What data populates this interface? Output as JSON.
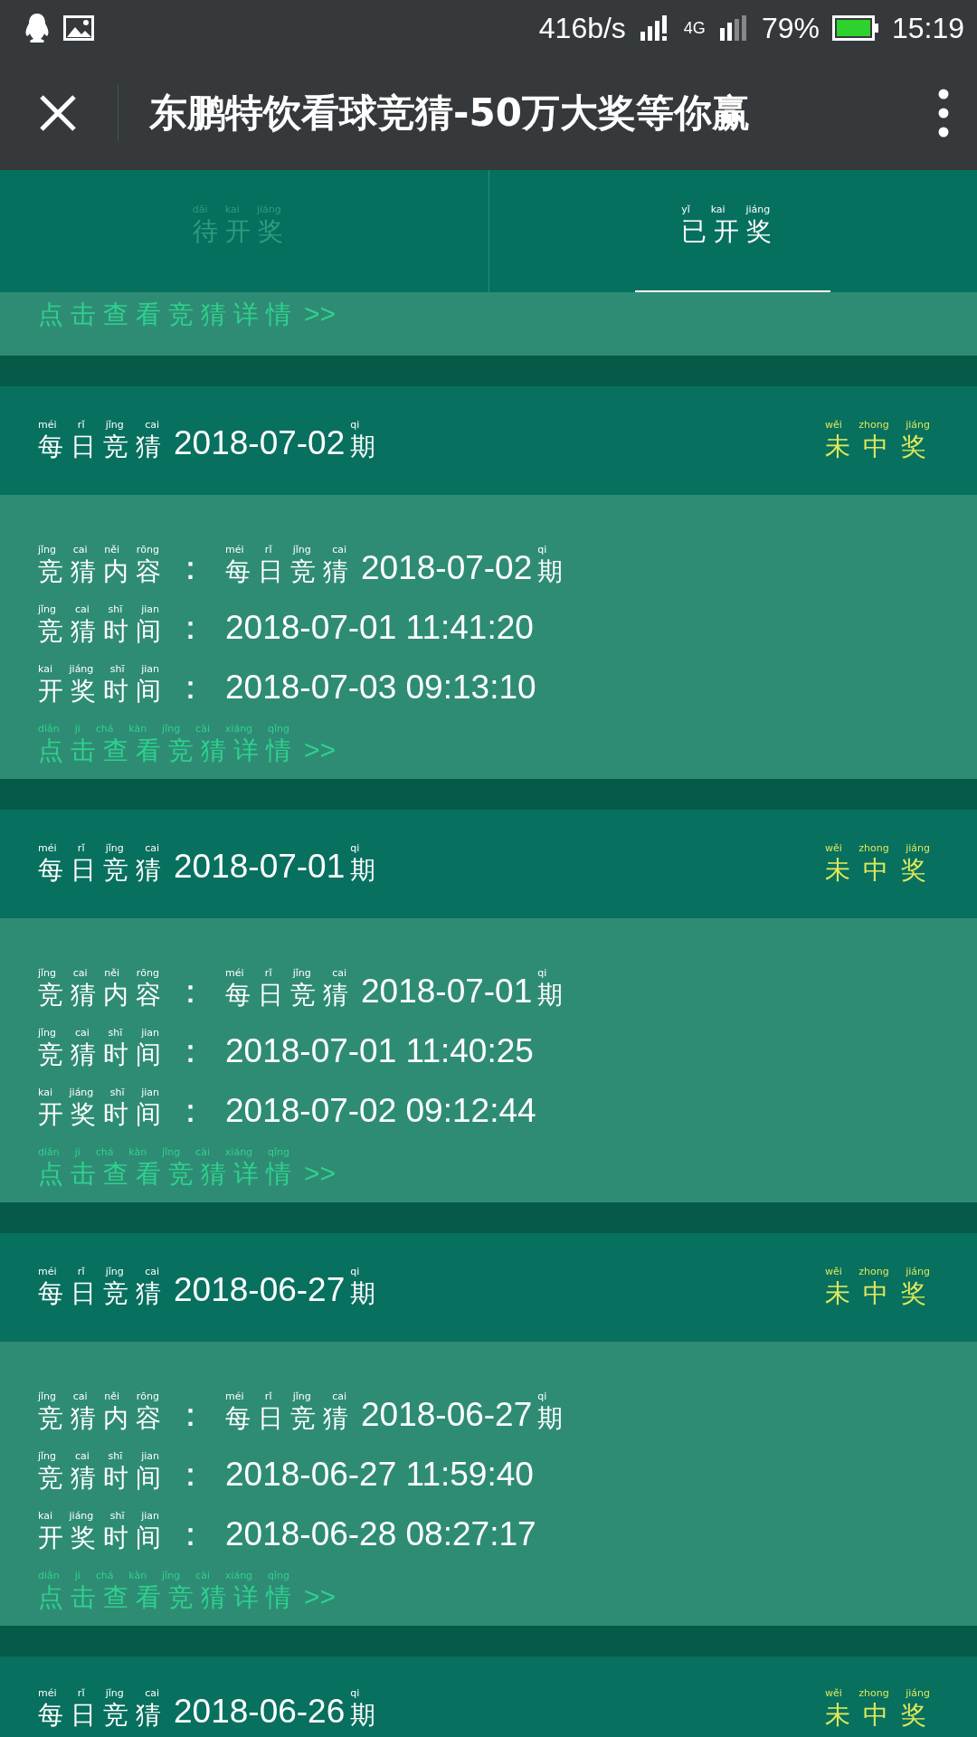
{
  "status_bar": {
    "speed": "416b/s",
    "network": "4G",
    "battery": "79%",
    "time": "15:19"
  },
  "app_bar": {
    "title": "东鹏特饮看球竞猜-50万大奖等你赢"
  },
  "tabs": [
    {
      "label": [
        {
          "zh": "待开奖",
          "py": "dāi kai jiáng"
        }
      ],
      "selected": false
    },
    {
      "label": [
        {
          "zh": "已开奖",
          "py": "yǐ kai jiáng"
        }
      ],
      "selected": true
    }
  ],
  "partial_card": {
    "link": [
      {
        "zh": "点击查看竞猜详情"
      },
      {
        "text": ">>"
      }
    ]
  },
  "cards": [
    {
      "title": [
        {
          "zh": "每日竞猜",
          "py": "méi rǐ jǐng cai"
        },
        {
          "text": "2018-07-02"
        },
        {
          "zh": "期",
          "py": "qi"
        }
      ],
      "result": [
        {
          "zh": "未中奖",
          "py": "wěi zhong jiáng"
        }
      ],
      "rows": [
        {
          "label": [
            {
              "zh": "竞猜内容",
              "py": "jǐng cai něi rōng"
            },
            {
              "text": "："
            }
          ],
          "value": [
            {
              "zh": "每日竞猜",
              "py": "méi rǐ jǐng cai"
            },
            {
              "text": "2018-07-02"
            },
            {
              "zh": "期",
              "py": "qi"
            }
          ]
        },
        {
          "label": [
            {
              "zh": "竞猜时间",
              "py": "jǐng cai shī jian"
            },
            {
              "text": "："
            }
          ],
          "value": [
            {
              "text": "2018-07-01 11:41:20"
            }
          ]
        },
        {
          "label": [
            {
              "zh": "开奖时间",
              "py": "kai jiáng shī jian"
            },
            {
              "text": "："
            }
          ],
          "value": [
            {
              "text": "2018-07-03 09:13:10"
            }
          ]
        }
      ],
      "link": [
        {
          "zh": "点击查看竞猜详情",
          "py": "diǎn ji chá kàn jǐng cài xiáng qǐng"
        },
        {
          "text": ">>"
        }
      ]
    },
    {
      "title": [
        {
          "zh": "每日竞猜",
          "py": "méi rǐ jǐng cai"
        },
        {
          "text": "2018-07-01"
        },
        {
          "zh": "期",
          "py": "qi"
        }
      ],
      "result": [
        {
          "zh": "未中奖",
          "py": "wěi zhong jiáng"
        }
      ],
      "rows": [
        {
          "label": [
            {
              "zh": "竞猜内容",
              "py": "jǐng cai něi rōng"
            },
            {
              "text": "："
            }
          ],
          "value": [
            {
              "zh": "每日竞猜",
              "py": "méi rǐ jǐng cai"
            },
            {
              "text": "2018-07-01"
            },
            {
              "zh": "期",
              "py": "qi"
            }
          ]
        },
        {
          "label": [
            {
              "zh": "竞猜时间",
              "py": "jǐng cai shī jian"
            },
            {
              "text": "："
            }
          ],
          "value": [
            {
              "text": "2018-07-01 11:40:25"
            }
          ]
        },
        {
          "label": [
            {
              "zh": "开奖时间",
              "py": "kai jiáng shī jian"
            },
            {
              "text": "："
            }
          ],
          "value": [
            {
              "text": "2018-07-02 09:12:44"
            }
          ]
        }
      ],
      "link": [
        {
          "zh": "点击查看竞猜详情",
          "py": "diǎn ji chá kàn jǐng cài xiáng qǐng"
        },
        {
          "text": ">>"
        }
      ]
    },
    {
      "title": [
        {
          "zh": "每日竞猜",
          "py": "méi rǐ jǐng cai"
        },
        {
          "text": "2018-06-27"
        },
        {
          "zh": "期",
          "py": "qi"
        }
      ],
      "result": [
        {
          "zh": "未中奖",
          "py": "wěi zhong jiáng"
        }
      ],
      "rows": [
        {
          "label": [
            {
              "zh": "竞猜内容",
              "py": "jǐng cai něi rōng"
            },
            {
              "text": "："
            }
          ],
          "value": [
            {
              "zh": "每日竞猜",
              "py": "méi rǐ jǐng cai"
            },
            {
              "text": "2018-06-27"
            },
            {
              "zh": "期",
              "py": "qi"
            }
          ]
        },
        {
          "label": [
            {
              "zh": "竞猜时间",
              "py": "jǐng cai shī jian"
            },
            {
              "text": "："
            }
          ],
          "value": [
            {
              "text": "2018-06-27 11:59:40"
            }
          ]
        },
        {
          "label": [
            {
              "zh": "开奖时间",
              "py": "kai jiáng shī jian"
            },
            {
              "text": "："
            }
          ],
          "value": [
            {
              "text": "2018-06-28 08:27:17"
            }
          ]
        }
      ],
      "link": [
        {
          "zh": "点击查看竞猜详情",
          "py": "diǎn ji chá kàn jǐng cài xiáng qǐng"
        },
        {
          "text": ">>"
        }
      ]
    },
    {
      "title": [
        {
          "zh": "每日竞猜",
          "py": "méi rǐ jǐng cai"
        },
        {
          "text": "2018-06-26"
        },
        {
          "zh": "期",
          "py": "qi"
        }
      ],
      "result": [
        {
          "zh": "未中奖",
          "py": "wěi zhong jiáng"
        }
      ]
    }
  ]
}
